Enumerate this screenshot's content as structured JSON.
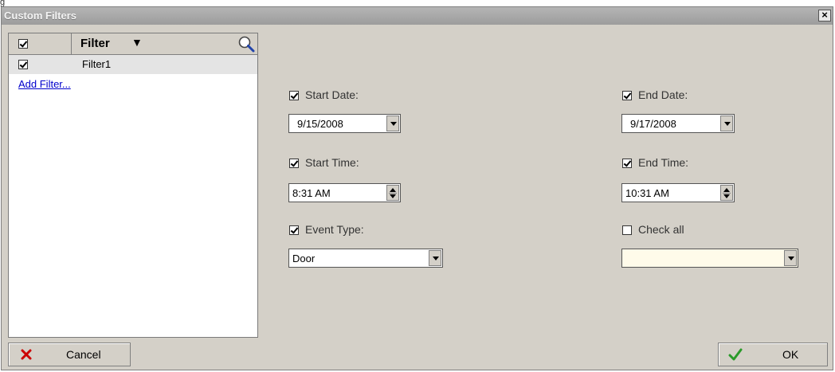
{
  "window": {
    "corner_mark": "g",
    "title": "Custom Filters",
    "close_glyph": "×"
  },
  "filter_list": {
    "header_label": "Filter",
    "sort_glyph": "▼",
    "header_checked": true,
    "rows": [
      {
        "label": "Filter1",
        "checked": true
      }
    ],
    "add_link": "Add Filter..."
  },
  "form": {
    "start_date": {
      "label": "Start Date:",
      "checked": true,
      "value": "9/15/2008"
    },
    "end_date": {
      "label": "End Date:",
      "checked": true,
      "value": "9/17/2008"
    },
    "start_time": {
      "label": "Start Time:",
      "checked": true,
      "value": "8:31 AM"
    },
    "end_time": {
      "label": "End Time:",
      "checked": true,
      "value": "10:31 AM"
    },
    "event_type": {
      "label": "Event Type:",
      "checked": true,
      "value": "Door"
    },
    "check_all": {
      "label": "Check all",
      "checked": false,
      "value": ""
    }
  },
  "buttons": {
    "cancel": "Cancel",
    "ok": "OK"
  },
  "icons": {
    "cancel": "x-icon",
    "ok": "check-icon",
    "search": "search-icon"
  },
  "colors": {
    "dialog_bg": "#d4d0c8",
    "title_bar": "#a8a8a8",
    "link": "#0000cc",
    "cancel_icon": "#cc0000",
    "ok_icon": "#2a9a2a",
    "selected_row": "#e4e4e4",
    "empty_combo": "#fffbea"
  }
}
